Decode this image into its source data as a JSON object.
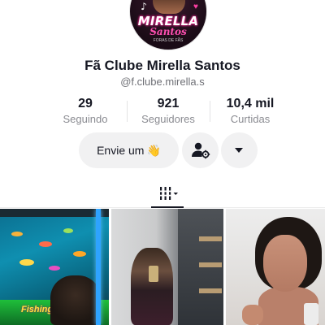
{
  "profile": {
    "avatar": {
      "banner_text": "MIRELLA",
      "script_text": "Santos",
      "sub_text": "FORAS DE FÃS"
    },
    "display_name": "Fã Clube Mirella Santos",
    "handle": "@f.clube.mirella.s"
  },
  "stats": [
    {
      "value": "29",
      "label": "Seguindo"
    },
    {
      "value": "921",
      "label": "Seguidores"
    },
    {
      "value": "10,4 mil",
      "label": "Curtidas"
    }
  ],
  "actions": {
    "message_label": "Envie um",
    "message_emoji": "👋",
    "follow_icon": "person-gear-icon",
    "more_icon": "caret-down-icon"
  },
  "tabs": {
    "active_icon": "video-grid-icon"
  },
  "videos": [
    {
      "thumb": "arcade-aquarium",
      "logo_text": "Fishing"
    },
    {
      "thumb": "mirror-selfie"
    },
    {
      "thumb": "face-closeup"
    }
  ],
  "colors": {
    "text_primary": "#161823",
    "text_secondary": "#8a8b91",
    "button_bg": "#f1f1f2",
    "accent_pink": "#ff4fb1"
  }
}
